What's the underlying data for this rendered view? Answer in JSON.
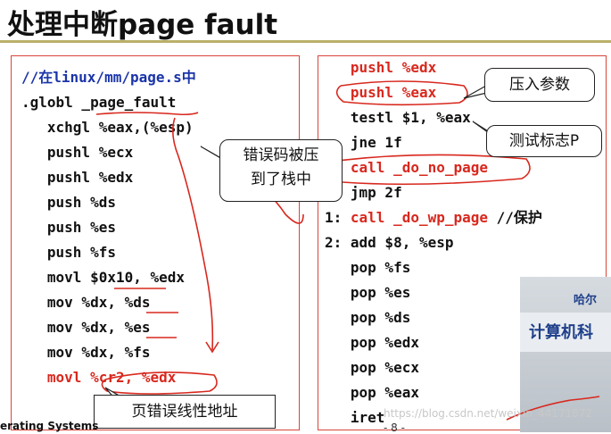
{
  "title": "处理中断page fault",
  "left_code": [
    {
      "text": "//在linux/mm/page.s中",
      "style": "blue"
    },
    {
      "text": ".globl _page_fault",
      "style": "normal"
    },
    {
      "text": "   xchgl %eax,(%esp)",
      "style": "normal"
    },
    {
      "text": "   pushl %ecx",
      "style": "normal"
    },
    {
      "text": "   pushl %edx",
      "style": "normal"
    },
    {
      "text": "   push %ds",
      "style": "normal"
    },
    {
      "text": "   push %es",
      "style": "normal"
    },
    {
      "text": "   push %fs",
      "style": "normal"
    },
    {
      "text": "   movl $0x10, %edx",
      "style": "normal"
    },
    {
      "text": "   mov %dx, %ds",
      "style": "normal"
    },
    {
      "text": "   mov %dx, %es",
      "style": "normal"
    },
    {
      "text": "   mov %dx, %fs",
      "style": "normal"
    },
    {
      "text": "   movl %cr2, %edx",
      "style": "red"
    }
  ],
  "right_code": [
    {
      "text": "   pushl %edx",
      "style": "red"
    },
    {
      "text": "   pushl %eax",
      "style": "red"
    },
    {
      "text": "   testl $1, %eax",
      "style": "normal"
    },
    {
      "text": "   jne 1f",
      "style": "normal"
    },
    {
      "text": "   call _do_no_page",
      "style": "red"
    },
    {
      "text": "   jmp 2f",
      "style": "normal"
    },
    {
      "prefix": "1: ",
      "text": "call _do_wp_page",
      "suffix": " //保护",
      "style": "mixed"
    },
    {
      "text": "2: add $8, %esp",
      "style": "normal"
    },
    {
      "text": "   pop %fs",
      "style": "normal"
    },
    {
      "text": "   pop %es",
      "style": "normal"
    },
    {
      "text": "   pop %ds",
      "style": "normal"
    },
    {
      "text": "   pop %edx",
      "style": "normal"
    },
    {
      "text": "   pop %ecx",
      "style": "normal"
    },
    {
      "text": "   pop %eax",
      "style": "normal"
    },
    {
      "text": "   iret",
      "style": "normal"
    }
  ],
  "callouts": {
    "error_code": "错误码被压\n到了栈中",
    "push_params": "压入参数",
    "test_p": "测试标志P",
    "page_error_addr": "页错误线性地址"
  },
  "footer": "erating Systems",
  "watermark": "https://blog.csdn.net/weixin_44171872",
  "page_number": "- 8 -",
  "video_sign": {
    "line1": "哈尔",
    "line2": "计算机科"
  },
  "colors": {
    "red": "#d8281e",
    "blue": "#1a34a8",
    "rule": "#b9b06a"
  }
}
